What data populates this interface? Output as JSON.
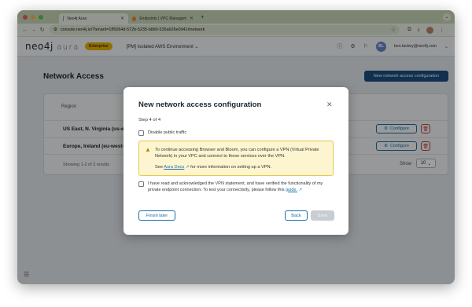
{
  "browser": {
    "tabs": [
      {
        "label": "Neo4j Aura",
        "active": true
      },
      {
        "label": "Endpoints | VPC Manageme...",
        "active": false
      }
    ],
    "url": "console.neo4j.io/?tenant=1ff5064d-572b-5235-b8d0-535ab26e0d41#network"
  },
  "app": {
    "logo": "neo4j",
    "logo_sub": "aura",
    "badge": "Enterprise",
    "environment": "[PM] Isolated AWS Environment",
    "user_initials": "BL",
    "user_email": "ben.lackey@neo4j.com"
  },
  "page": {
    "title": "Network Access",
    "new_button": "New network access configuration",
    "column_region": "Region",
    "rows": [
      {
        "name": "US East, N. Virginia (us-ea"
      },
      {
        "name": "Europe, Ireland (eu-west-1"
      }
    ],
    "configure_label": "Configure",
    "showing_text": "Showing 1-2 of 2 results",
    "show_label": "Show",
    "show_value": "10"
  },
  "modal": {
    "title": "New network access configuration",
    "step": "Step 4 of 4",
    "disable_public": "Disable public traffic",
    "alert_text": "To continue accessing Browser and Bloom, you can configure a VPN (Virtual Private Network) in your VPC and connect to these services over the VPN.",
    "alert_see": "See",
    "alert_link": "Aura Docs",
    "alert_more": "for more information on setting up a VPN.",
    "ack_text": "I have read and acknowledged the VPN statement, and have verified the functionality of my private endpoint connection. To test your connectivity, please follow this",
    "ack_link": "guide.",
    "finish_later": "Finish later",
    "back": "Back",
    "save": "Save"
  },
  "colors": {
    "primary": "#1a4e80",
    "link": "#1a6ea8",
    "badge": "#e7b400",
    "danger": "#c24545"
  }
}
